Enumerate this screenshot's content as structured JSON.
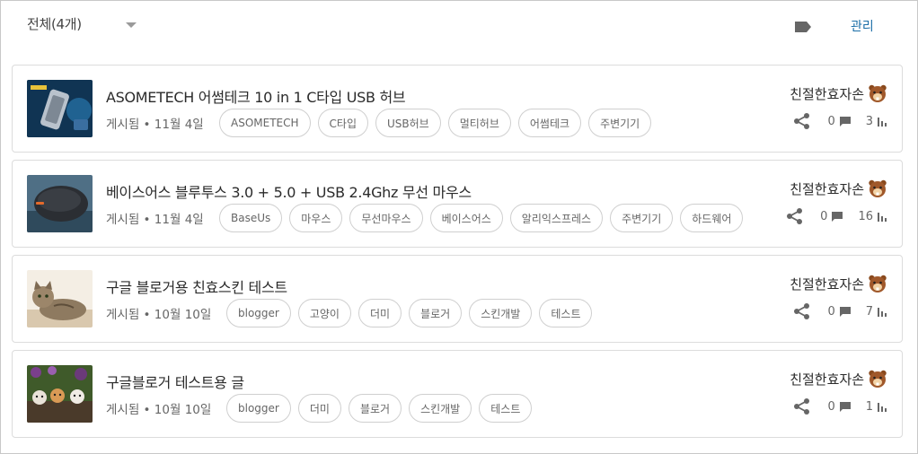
{
  "header": {
    "filter_label": "전체(4개)",
    "label_icon": "label-tag-icon",
    "manage_label": "관리"
  },
  "posts": [
    {
      "title": "ASOMETECH 어썸테크 10 in 1 C타입 USB 허브",
      "status": "게시됨 • 11월 4일",
      "tags": [
        "ASOMETECH",
        "C타입",
        "USB허브",
        "멀티허브",
        "어썸테크",
        "주변기기"
      ],
      "author": "친절한효자손",
      "comments": "0",
      "views": "3",
      "thumb_icon": "usb-hub-thumbnail"
    },
    {
      "title": "베이스어스 블루투스 3.0 + 5.0 + USB 2.4Ghz 무선 마우스",
      "status": "게시됨 • 11월 4일",
      "tags": [
        "BaseUs",
        "마우스",
        "무선마우스",
        "베이스어스",
        "알리익스프레스",
        "주변기기",
        "하드웨어"
      ],
      "author": "친절한효자손",
      "comments": "0",
      "views": "16",
      "thumb_icon": "mouse-thumbnail"
    },
    {
      "title": "구글 블로거용 친효스킨 테스트",
      "status": "게시됨 • 10월 10일",
      "tags": [
        "blogger",
        "고양이",
        "더미",
        "블로거",
        "스킨개발",
        "테스트"
      ],
      "author": "친절한효자손",
      "comments": "0",
      "views": "7",
      "thumb_icon": "cat-thumbnail"
    },
    {
      "title": "구글블로거 테스트용 글",
      "status": "게시됨 • 10월 10일",
      "tags": [
        "blogger",
        "더미",
        "블로거",
        "스킨개발",
        "테스트"
      ],
      "author": "친절한효자손",
      "comments": "0",
      "views": "1",
      "thumb_icon": "kittens-thumbnail"
    }
  ]
}
